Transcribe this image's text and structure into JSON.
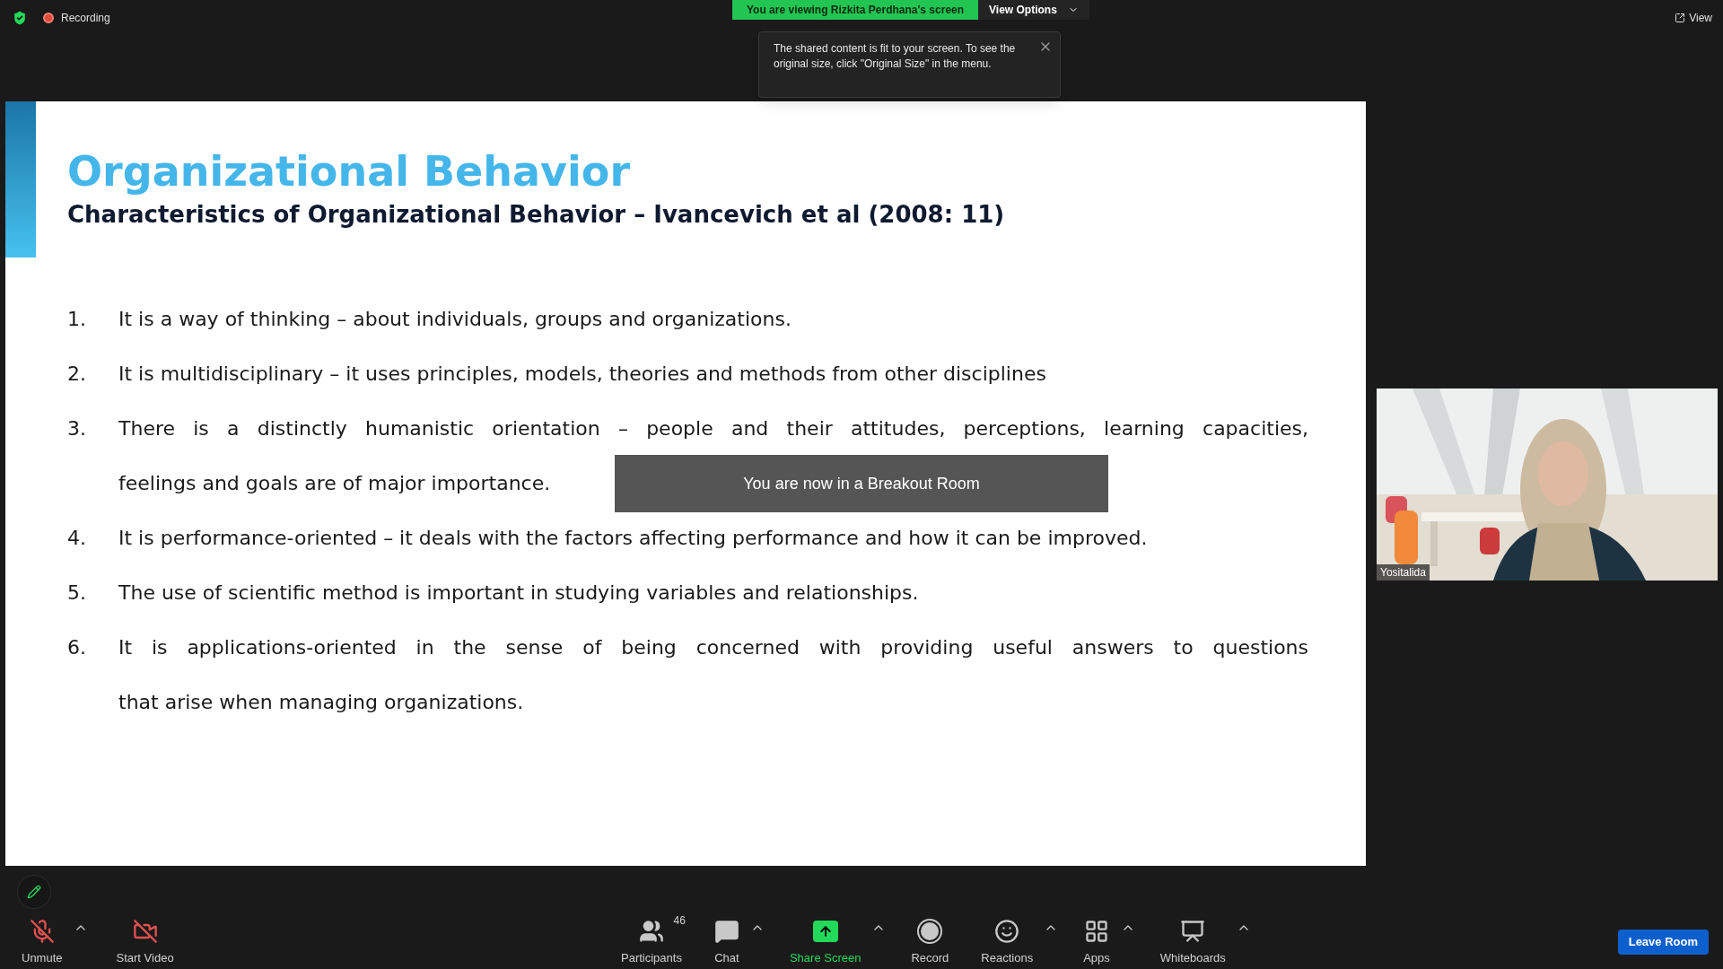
{
  "top_bar": {
    "recording": {
      "label": "Recording"
    },
    "share_banner": "You are viewing Rizkita Perdhana's screen",
    "view_options": "View Options",
    "view_button": "View"
  },
  "tooltip": {
    "text": "The shared content is fit to your screen. To see the original size, click \"Original Size\" in the menu."
  },
  "slide": {
    "title": "Organizational Behavior",
    "subtitle": "Characteristics of Organizational Behavior – Ivancevich et al (2008: 11)",
    "items": [
      {
        "number": "1.",
        "lines": [
          "It is a way of thinking – about individuals, groups and organizations."
        ]
      },
      {
        "number": "2.",
        "lines": [
          "It is multidisciplinary – it uses principles, models, theories and methods from other disciplines"
        ]
      },
      {
        "number": "3.",
        "lines": [
          "There is a distinctly humanistic orientation – people and their attitudes, perceptions, learning capacities,",
          "feelings and goals are of major importance."
        ]
      },
      {
        "number": "4.",
        "lines": [
          "It is performance-oriented – it deals with the factors affecting performance and how it can be improved."
        ]
      },
      {
        "number": "5.",
        "lines": [
          "The use of scientific method is important in studying variables and relationships."
        ]
      },
      {
        "number": "6.",
        "lines": [
          "It is applications-oriented in the sense of being concerned with providing useful answers to questions",
          "that arise when managing organizations."
        ]
      }
    ]
  },
  "breakout_toast": "You are now in a Breakout Room",
  "video_tile": {
    "kind": "picture",
    "name": "Yositalida"
  },
  "toolbar": {
    "left": [
      {
        "kind": "mic",
        "label": "Unmute",
        "caret": true
      },
      {
        "kind": "video",
        "label": "Start Video",
        "caret": false
      }
    ],
    "center": [
      {
        "kind": "participants",
        "label": "Participants",
        "count": "46",
        "caret": false,
        "active": false
      },
      {
        "kind": "chat",
        "label": "Chat",
        "caret": true,
        "active": false
      },
      {
        "kind": "share",
        "label": "Share Screen",
        "caret": true,
        "active": true
      },
      {
        "kind": "record",
        "label": "Record",
        "caret": false,
        "active": false
      },
      {
        "kind": "reactions",
        "label": "Reactions",
        "caret": true,
        "active": false
      },
      {
        "kind": "apps",
        "label": "Apps",
        "caret": true,
        "active": false
      },
      {
        "kind": "whiteboards",
        "label": "Whiteboards",
        "caret": true,
        "active": false
      }
    ],
    "leave": "Leave Room"
  }
}
